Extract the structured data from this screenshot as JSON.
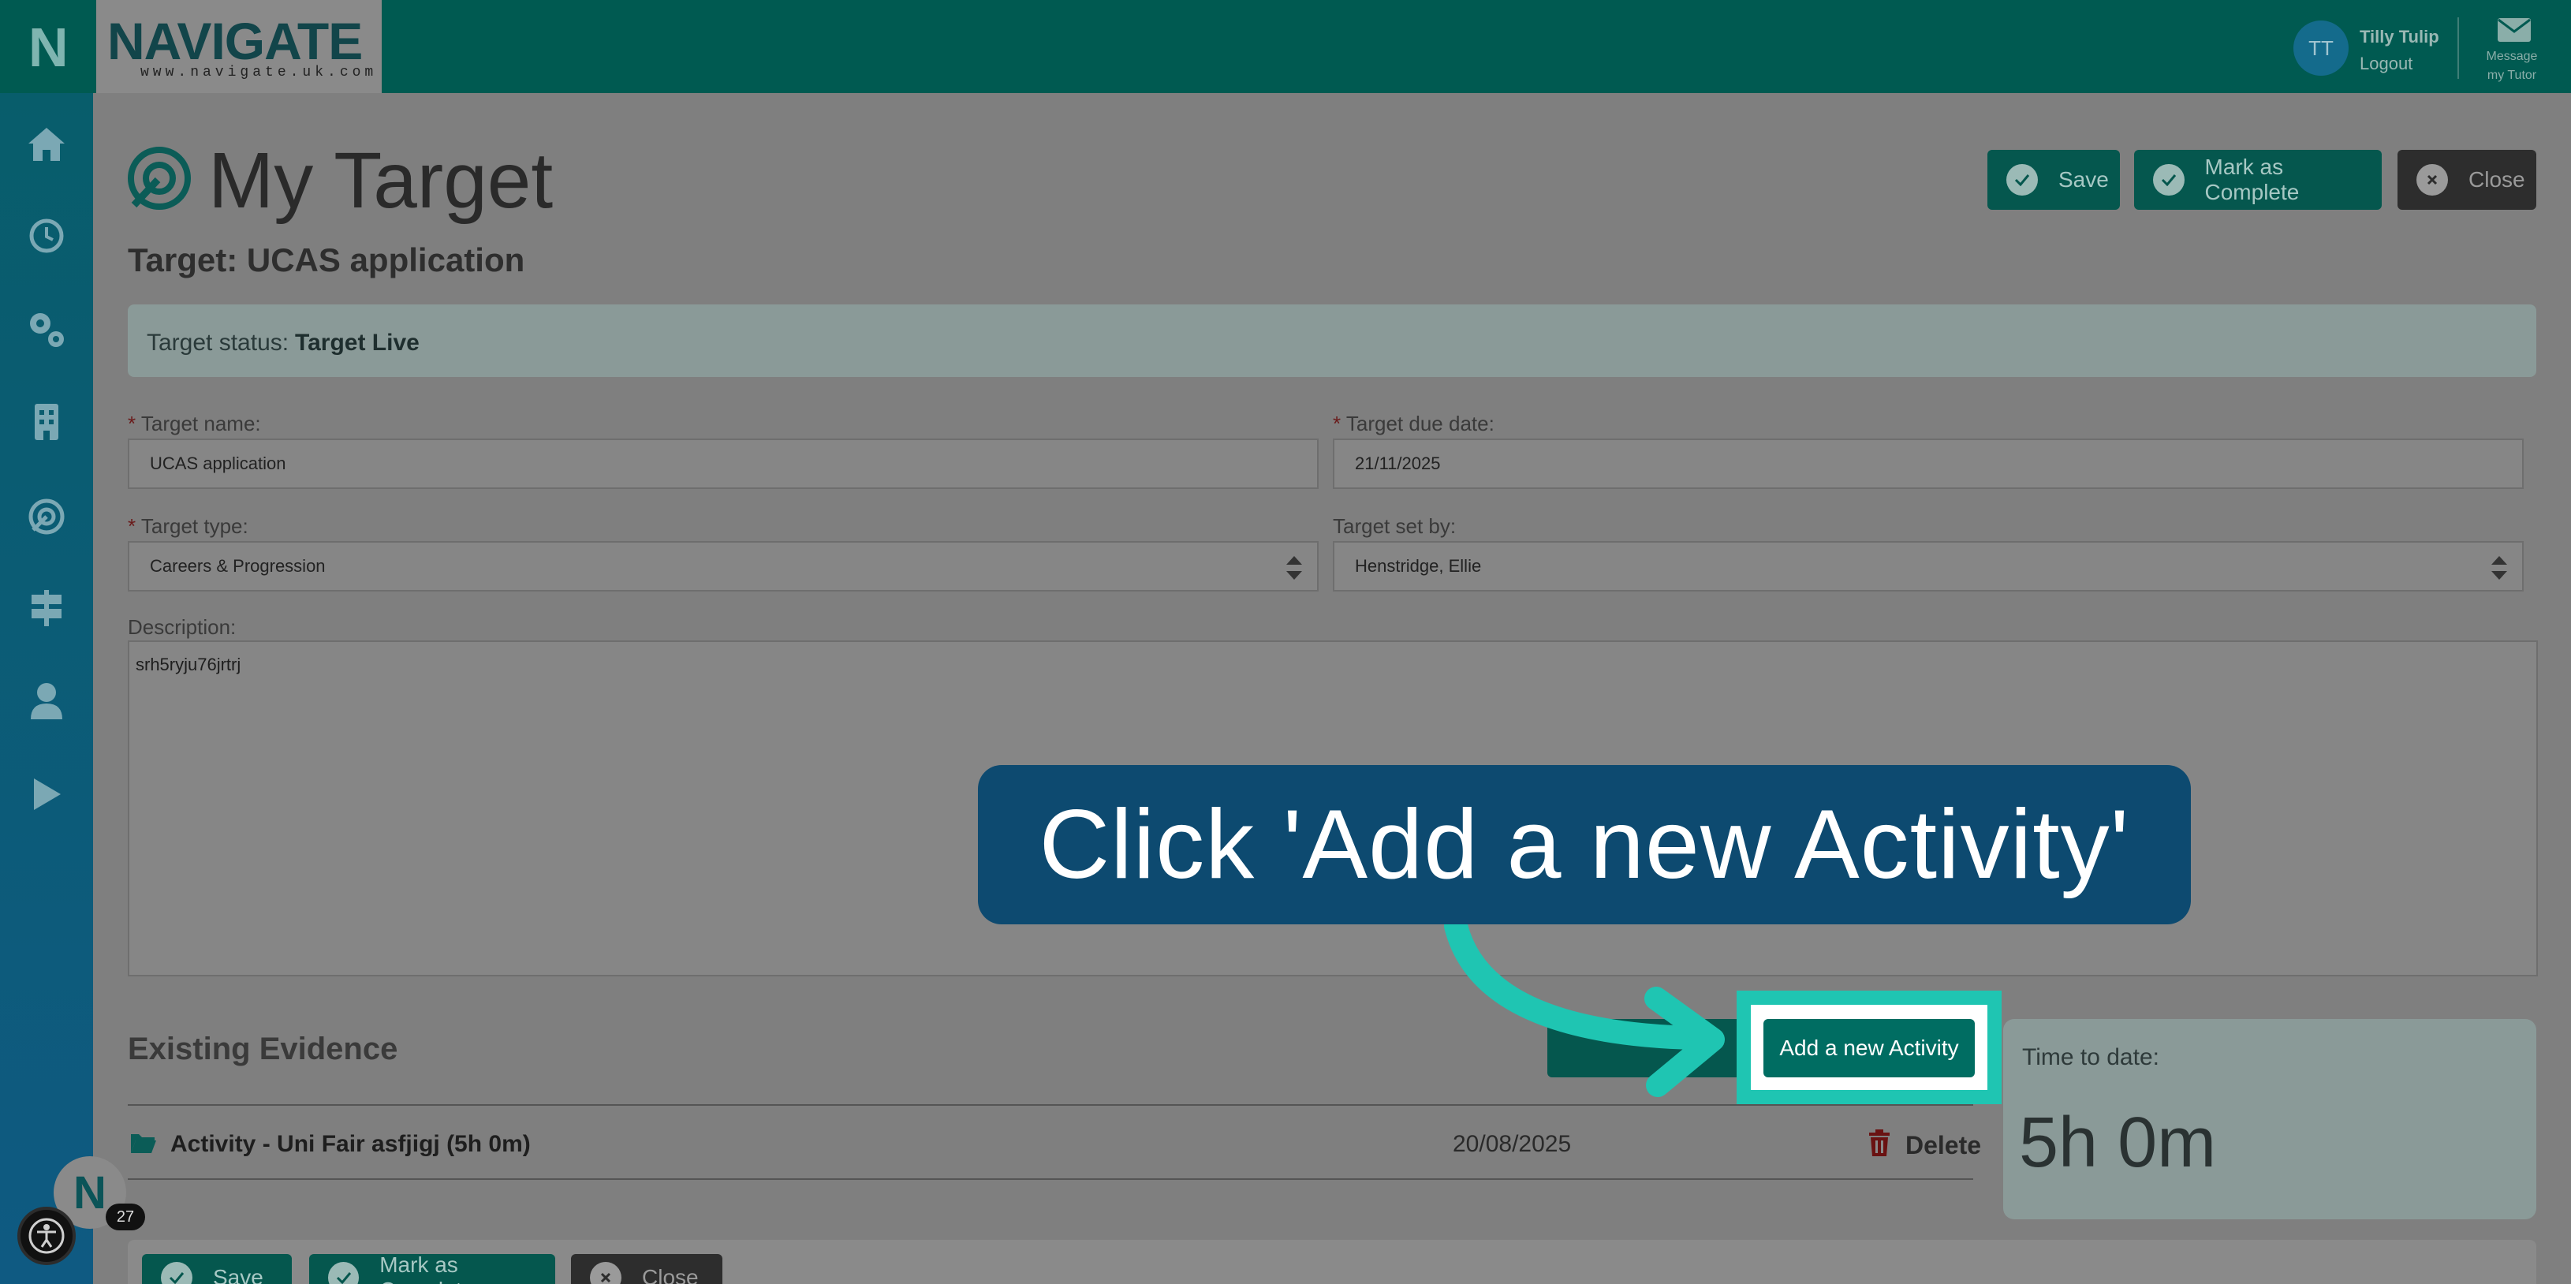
{
  "header": {
    "logo_text": "NAVIGATE",
    "logo_url": "www.navigate.uk.com",
    "user_initials": "TT",
    "user_name": "Tilly Tulip",
    "logout_label": "Logout",
    "message_label": "Message my Tutor"
  },
  "sidebar": {
    "brand_letter": "N",
    "items": [
      {
        "icon": "home-icon"
      },
      {
        "icon": "clock-icon"
      },
      {
        "icon": "gears-icon"
      },
      {
        "icon": "building-icon"
      },
      {
        "icon": "target-icon"
      },
      {
        "icon": "signpost-icon"
      },
      {
        "icon": "user-icon"
      },
      {
        "icon": "play-icon"
      }
    ]
  },
  "page": {
    "title": "My Target",
    "target_heading": "Target: UCAS application",
    "status_label": "Target status:",
    "status_value": "Target Live"
  },
  "toolbar": {
    "save_label": "Save",
    "complete_label": "Mark as Complete",
    "close_label": "Close"
  },
  "form": {
    "target_name_label": "Target name:",
    "target_name_value": "UCAS application",
    "due_date_label": "Target due date:",
    "due_date_value": "21/11/2025",
    "type_label": "Target type:",
    "type_value": "Careers & Progression",
    "set_by_label": "Target set by:",
    "set_by_value": "Henstridge, Ellie",
    "required_mark": "*",
    "description_label": "Description:",
    "description_value": "srh5ryju76jrtrj"
  },
  "evidence": {
    "section_title": "Existing Evidence",
    "add_activity_label": "Add a new Activity",
    "items": [
      {
        "title": "Activity - Uni Fair asfjigj (5h 0m)",
        "date": "20/08/2025",
        "delete_label": "Delete"
      }
    ],
    "time_label": "Time to date:",
    "time_value": "5h 0m"
  },
  "widgets": {
    "notification_count": "27"
  },
  "callout": {
    "text": "Click 'Add a new Activity'"
  },
  "colors": {
    "brand_teal": "#006d62",
    "highlight": "#1fc5b2",
    "callout_bg": "#0d4a70"
  }
}
